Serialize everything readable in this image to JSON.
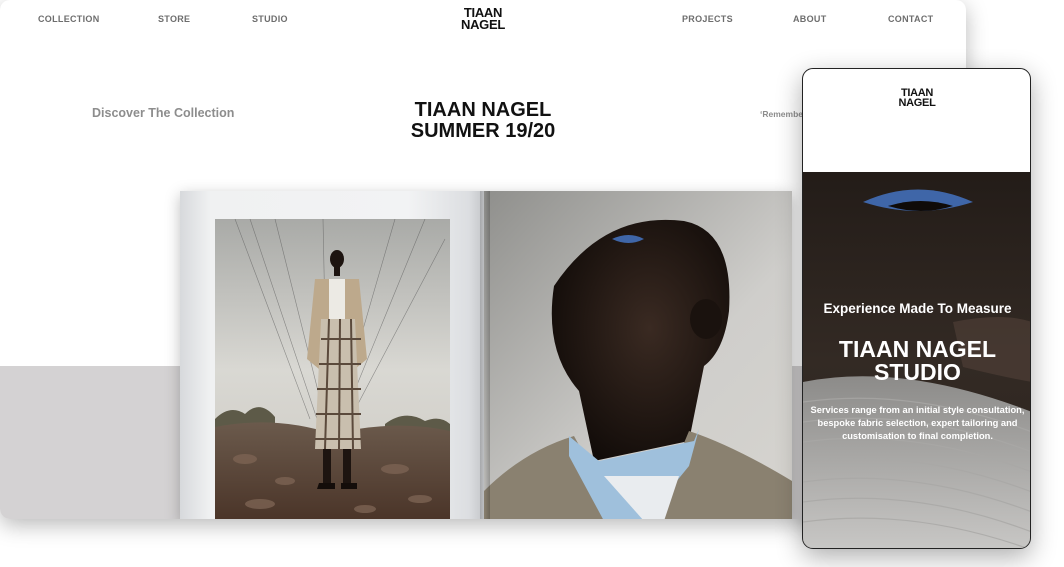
{
  "desktop": {
    "nav": {
      "left": [
        "COLLECTION",
        "STORE",
        "STUDIO"
      ],
      "right": [
        "PROJECTS",
        "ABOUT",
        "CONTACT"
      ]
    },
    "logo": {
      "line1": "TIAAN",
      "line2": "NAGEL"
    },
    "discover_link": "Discover The Collection",
    "hero_title": {
      "line1": "TIAAN NAGEL",
      "line2": "SUMMER 19/20"
    },
    "quote_snippet": "‘Remember",
    "magazine": {
      "left_photo": "model-standing-landscape-image",
      "right_photo": "model-portrait-image"
    }
  },
  "mobile": {
    "logo": {
      "line1": "TIAAN",
      "line2": "NAGEL"
    },
    "eyebrow": "Experience Made To Measure",
    "title": {
      "line1": "TIAAN NAGEL",
      "line2": "STUDIO"
    },
    "body": "Services range from an initial style consultation, bespoke fabric selection, expert tailoring and customisation to final completion."
  },
  "colors": {
    "text_dark": "#111111",
    "text_muted": "#8d8d8d",
    "nav_text": "#6d6d6d",
    "band_grey": "#d4d2d3",
    "eyeshadow_blue": "#3f66a8",
    "collar_blue": "#9fc0dc"
  }
}
